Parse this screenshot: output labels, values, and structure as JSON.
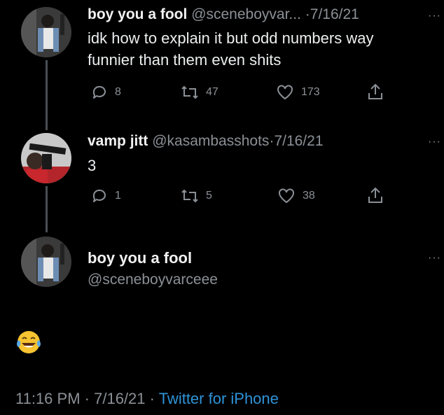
{
  "tweet1": {
    "name": "boy you a fool",
    "handle": "@sceneboyvar...",
    "date": "7/16/21",
    "text_line1": "idk how to explain it but odd numbers way",
    "text_line2": "funnier than them even shits",
    "replies": "8",
    "retweets": "47",
    "likes": "173",
    "more": "···"
  },
  "tweet2": {
    "name": "vamp jitt",
    "handle": "@kasambasshots",
    "date": "7/16/21",
    "text": "3",
    "replies": "1",
    "retweets": "5",
    "likes": "38",
    "more": "···"
  },
  "main": {
    "name": "boy you a fool",
    "handle": "@sceneboyvarceee",
    "more": "···",
    "emoji": "face-with-tears-of-joy"
  },
  "footer": {
    "time": "11:16 PM",
    "date": "7/16/21",
    "separator": "·",
    "source": "Twitter for iPhone"
  },
  "colors": {
    "background": "#000000",
    "muted": "#8b9096",
    "link": "#2f93d8"
  }
}
